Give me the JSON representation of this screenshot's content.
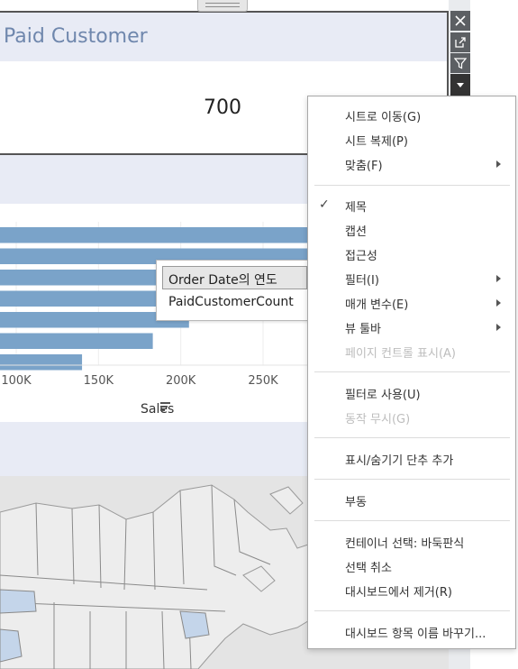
{
  "kpi": {
    "title": "Paid Customer",
    "value": "700"
  },
  "bar_chart": {
    "x_ticks": [
      "100K",
      "150K",
      "200K",
      "250K"
    ],
    "x_label": "Sales",
    "sort_icon": "sort-descending-icon"
  },
  "chart_data": {
    "type": "bar",
    "orientation": "horizontal",
    "xlabel": "Sales",
    "x_ticks": [
      "100K",
      "150K",
      "200K",
      "250K"
    ],
    "values": [
      350000,
      350000,
      350000,
      350000,
      205000,
      183000,
      140000
    ],
    "note": "bars truncated at left edge; values approximate"
  },
  "tooltip": {
    "row_1": "Order Date의 연도",
    "row_2": "PaidCustomerCount"
  },
  "tools": {
    "close": "close-icon",
    "open": "open-external-icon",
    "filter": "filter-icon",
    "more": "caret-down-icon"
  },
  "menu": {
    "items": [
      {
        "label": "시트로 이동(G)",
        "disabled": false,
        "submenu": false,
        "checked": false
      },
      {
        "label": "시트 복제(P)",
        "disabled": false,
        "submenu": false,
        "checked": false
      },
      {
        "label": "맞춤(F)",
        "disabled": false,
        "submenu": true,
        "checked": false
      },
      {
        "label": "제목",
        "disabled": false,
        "submenu": false,
        "checked": true
      },
      {
        "label": "캡션",
        "disabled": false,
        "submenu": false,
        "checked": false
      },
      {
        "label": "접근성",
        "disabled": false,
        "submenu": false,
        "checked": false
      },
      {
        "label": "필터(I)",
        "disabled": false,
        "submenu": true,
        "checked": false
      },
      {
        "label": "매개 변수(E)",
        "disabled": false,
        "submenu": true,
        "checked": false
      },
      {
        "label": "뷰 툴바",
        "disabled": false,
        "submenu": true,
        "checked": false
      },
      {
        "label": "페이지 컨트롤 표시(A)",
        "disabled": true,
        "submenu": false,
        "checked": false
      },
      {
        "label": "필터로 사용(U)",
        "disabled": false,
        "submenu": false,
        "checked": false
      },
      {
        "label": "동작 무시(G)",
        "disabled": true,
        "submenu": false,
        "checked": false
      },
      {
        "label": "표시/숨기기 단추 추가",
        "disabled": false,
        "submenu": false,
        "checked": false
      },
      {
        "label": "부동",
        "disabled": false,
        "submenu": false,
        "checked": false
      },
      {
        "label": "컨테이너 선택: 바둑판식",
        "disabled": false,
        "submenu": false,
        "checked": false
      },
      {
        "label": "선택 취소",
        "disabled": false,
        "submenu": false,
        "checked": false
      },
      {
        "label": "대시보드에서 제거(R)",
        "disabled": false,
        "submenu": false,
        "checked": false
      },
      {
        "label": "대시보드 항목 이름 바꾸기...",
        "disabled": false,
        "submenu": false,
        "checked": false
      }
    ],
    "check_glyph": "✓"
  },
  "colors": {
    "bar": "#7aa3c9",
    "title": "#6f87ad",
    "header_band": "#e8ebf5"
  }
}
